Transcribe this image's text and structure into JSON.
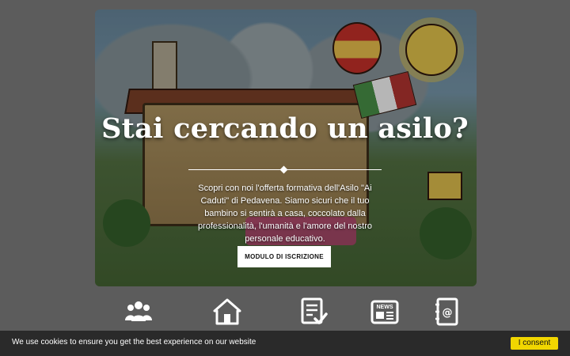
{
  "hero": {
    "title": "Stai cercando un asilo?",
    "description": "Scopri con noi l'offerta formativa dell'Asilo \"Ai Caduti\" di Pedavena. Siamo sicuri che il tuo bambino si sentirà a casa, coccolato dalla professionalità, l'umanità e l'amore del nostro personale educativo.",
    "cta_label": "MODULO DI ISCRIZIONE"
  },
  "icons": [
    {
      "name": "users-group-icon"
    },
    {
      "name": "home-icon"
    },
    {
      "name": "document-check-icon"
    },
    {
      "name": "news-icon"
    },
    {
      "name": "contact-book-icon"
    }
  ],
  "cookie": {
    "message": "We use cookies to ensure you get the best experience on our website",
    "accept_label": "I consent"
  },
  "colors": {
    "overlay_bg": "#5c5c5c",
    "cookie_bar": "#2a2a2a",
    "cookie_button": "#f1d600",
    "icon": "#ffffff"
  }
}
